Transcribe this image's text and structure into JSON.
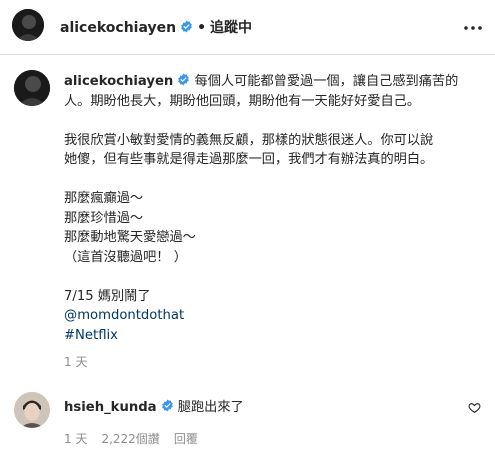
{
  "header": {
    "username": "alicekochiayen",
    "separator": "•",
    "follow_label": "追蹤中"
  },
  "post": {
    "username": "alicekochiayen",
    "lines": [
      "每個人可能都曾愛過一個，讓自己感到痛苦的",
      "人。期盼他長大，期盼他回頭，期盼他有一天能好好愛自己。",
      "",
      "我很欣賞小敏對愛情的義無反顧，那樣的狀態很迷人。你可以說",
      "她傻，但有些事就是得走過那麼一回，我們才有辦法真的明白。",
      "",
      "那麼瘋癲過～",
      "那麼珍惜過～",
      "那麼動地驚天愛戀過～",
      "（這首沒聽過吧！ ）",
      "",
      "7/15 媽別鬧了"
    ],
    "mention": "@momdontdothat",
    "hashtag": "#Netflix",
    "time": "1 天"
  },
  "comment": {
    "username": "hsieh_kunda",
    "text": "腿跑出來了",
    "time": "1 天",
    "likes": "2,222個讚",
    "reply_label": "回覆"
  },
  "colors": {
    "verified": "#3897f0",
    "link": "#00376b",
    "muted": "#8e8e8e",
    "text": "#262626"
  },
  "icons": {
    "verified": "verified-badge-icon",
    "more": "more-options-icon",
    "like": "heart-icon"
  }
}
